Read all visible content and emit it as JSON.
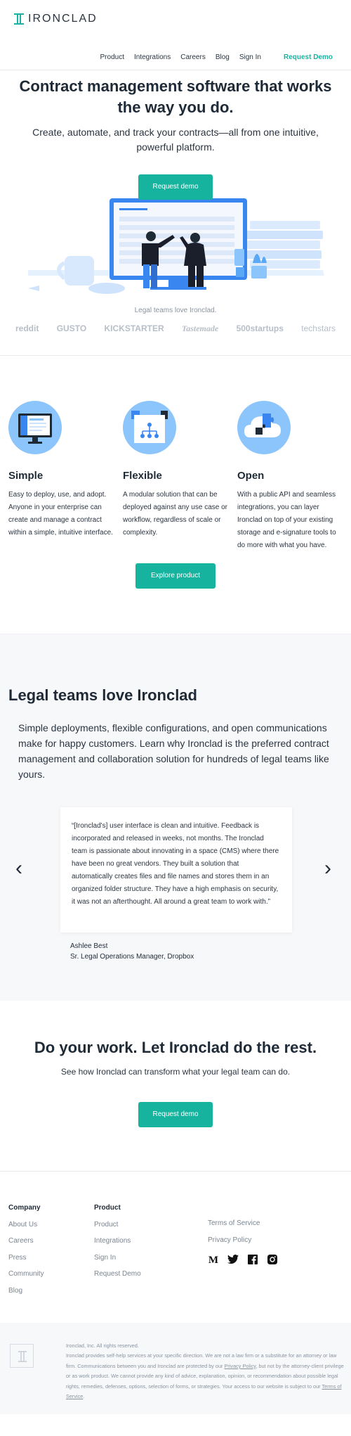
{
  "header": {
    "logo_text": "IRONCLAD",
    "nav": [
      "Product",
      "Integrations",
      "Careers",
      "Blog",
      "Sign In"
    ],
    "cta": "Request Demo"
  },
  "hero": {
    "title": "Contract management software that works the way you do.",
    "subtitle": "Create, automate, and track your contracts—all from one intuitive, powerful platform.",
    "button": "Request demo",
    "logos_caption": "Legal teams love Ironclad.",
    "logos": [
      "reddit",
      "GUSTO",
      "KICKSTARTER",
      "Tastemade",
      "500startups",
      "techstars"
    ]
  },
  "features": [
    {
      "title": "Simple",
      "text": "Easy to deploy, use, and adopt. Anyone in your enterprise can create and manage a contract within a simple, intuitive interface.",
      "icon": "monitor-icon"
    },
    {
      "title": "Flexible",
      "text": "A modular solution that can be deployed against any use case or workflow, regardless of scale or complexity.",
      "icon": "workflow-icon"
    },
    {
      "title": "Open",
      "text": "With a public API and seamless integrations, you can layer Ironclad on top of your existing storage and e-signature tools to do more with what you have.",
      "icon": "puzzle-cloud-icon"
    }
  ],
  "explore_button": "Explore product",
  "testimonials": {
    "title": "Legal teams love Ironclad",
    "subtitle": "Simple deployments, flexible configurations, and open communications make for happy customers. Learn why Ironclad is the preferred contract management and collaboration solution for hundreds of legal teams like yours.",
    "quote": "“[Ironclad's] user interface is clean and intuitive. Feedback is incorporated and released in weeks, not months. The Ironclad team is passionate about innovating in a space (CMS) where there have been no great vendors. They built a solution that automatically creates files and file names and stores them in an organized folder structure. They have a high emphasis on security, it was not an afterthought. All around a great team to work with.”",
    "author_name": "Ashlee Best",
    "author_title": "Sr. Legal Operations Manager, Dropbox"
  },
  "cta": {
    "title": "Do your work. Let Ironclad do the rest.",
    "subtitle": "See how Ironclad can transform what your legal team can do.",
    "button": "Request demo"
  },
  "footer": {
    "company_heading": "Company",
    "company_links": [
      "About Us",
      "Careers",
      "Press",
      "Community",
      "Blog"
    ],
    "product_heading": "Product",
    "product_links": [
      "Product",
      "Integrations",
      "Sign In",
      "Request Demo"
    ],
    "legal_links": [
      "Terms of Service",
      "Privacy Policy"
    ],
    "social": [
      "medium-icon",
      "twitter-icon",
      "facebook-icon",
      "instagram-icon"
    ]
  },
  "legal": {
    "rights": "Ironclad, Inc. All rights reserved.",
    "text_1": "Ironclad provides self-help services at your specific direction. We are not a law firm or a substitute for an attorney or law firm. Communications between you and Ironclad are protected by our ",
    "privacy_link": "Privacy Policy",
    "text_2": ", but not by the attorney-client privilege or as work product. We cannot provide any kind of advice, explanation, opinion, or recommendation about possible legal rights, remedies, defenses, options, selection of forms, or strategies. Your access to our website is subject to our ",
    "terms_link": "Terms of Service",
    "text_3": "."
  },
  "colors": {
    "brand": "#16b49e",
    "illustration_blue": "#8cc5fb",
    "text_dark": "#1f2a37"
  }
}
